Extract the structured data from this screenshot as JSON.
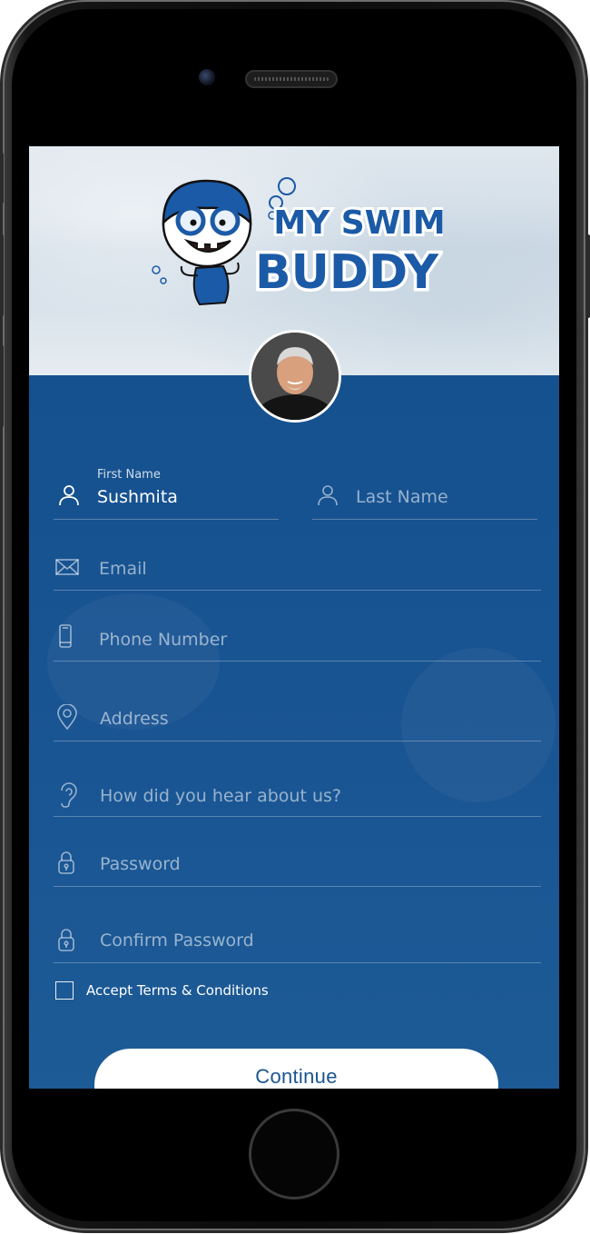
{
  "brand": {
    "logo_line1": "MY SWIM",
    "logo_line2": "BUDDY",
    "color_primary": "#15518f",
    "color_logo_text": "#1b5aa6"
  },
  "form": {
    "first_name": {
      "label": "First Name",
      "value": "Sushmita",
      "icon": "user-icon"
    },
    "last_name": {
      "placeholder": "Last Name",
      "icon": "user-icon"
    },
    "email": {
      "placeholder": "Email",
      "icon": "envelope-icon"
    },
    "phone": {
      "placeholder": "Phone Number",
      "icon": "phone-icon"
    },
    "address": {
      "placeholder": "Address",
      "icon": "location-pin-icon"
    },
    "referral": {
      "placeholder": "How did you hear about us?",
      "icon": "ear-icon"
    },
    "password": {
      "placeholder": "Password",
      "icon": "lock-icon"
    },
    "confirm_password": {
      "placeholder": "Confirm Password",
      "icon": "lock-icon"
    },
    "terms": {
      "label": "Accept Terms & Conditions",
      "checked": false
    }
  },
  "actions": {
    "continue_label": "Continue"
  }
}
